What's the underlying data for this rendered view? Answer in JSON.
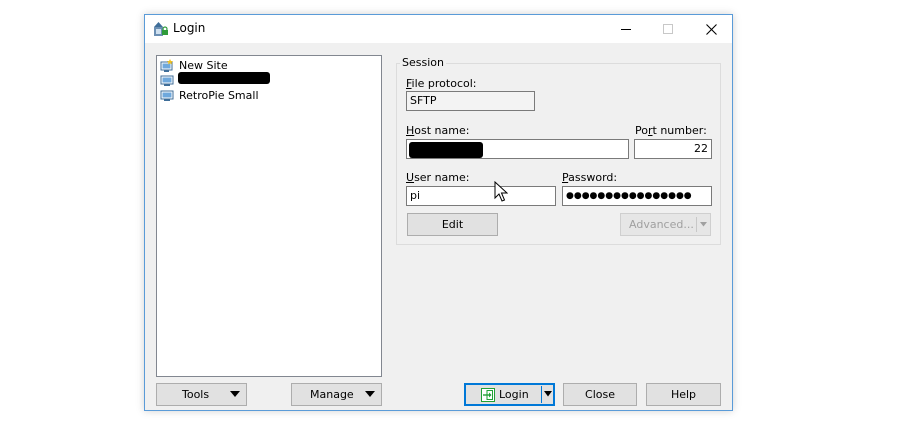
{
  "window": {
    "title": "Login"
  },
  "sites": [
    {
      "label": "New Site"
    },
    {
      "label": ""
    },
    {
      "label": "RetroPie Small"
    }
  ],
  "session": {
    "group_label": "Session",
    "file_protocol": {
      "label_key": "F",
      "label_rest": "ile protocol:",
      "value": "SFTP"
    },
    "host_name": {
      "label_key": "H",
      "label_rest": "ost name:",
      "value": ""
    },
    "port_number": {
      "label_pre": "Po",
      "label_key": "r",
      "label_rest": "t number:",
      "value": "22"
    },
    "user_name": {
      "label_key": "U",
      "label_rest": "ser name:",
      "value": "pi"
    },
    "password": {
      "label_key": "P",
      "label_rest": "assword:",
      "value": "●●●●●●●●●●●●●●●●"
    },
    "edit_label": "Edit",
    "advanced_label": "Advanced..."
  },
  "buttons": {
    "tools": "Tools",
    "manage": "Manage",
    "login": "Login",
    "close": "Close",
    "help": "Help"
  },
  "colors": {
    "window_border": "#5a9bd8",
    "login_border": "#0078d7",
    "login_icon": "#22a035"
  }
}
